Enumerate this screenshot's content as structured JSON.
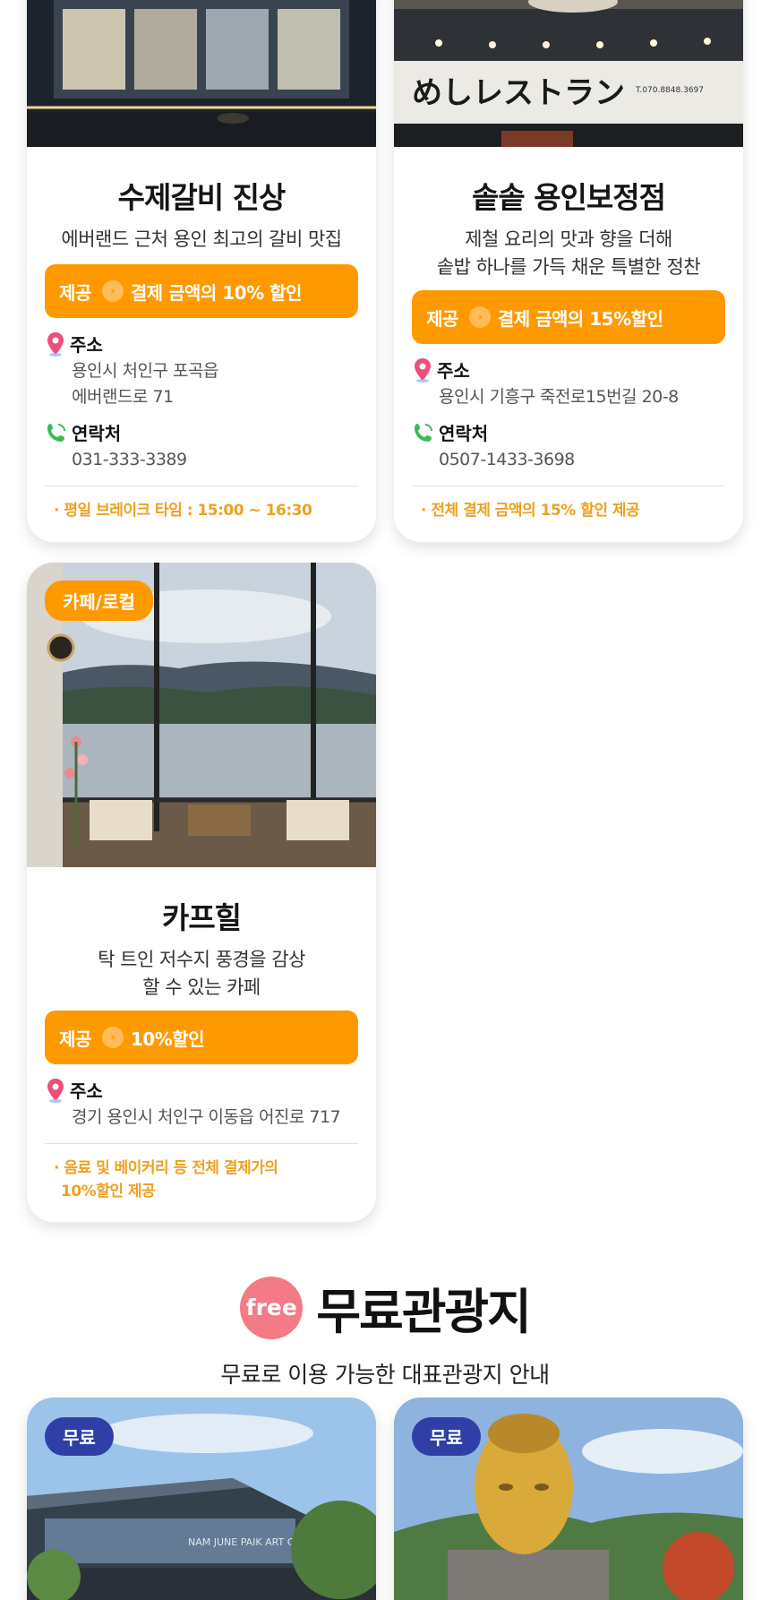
{
  "cards": [
    {
      "title": "수제갈비 진상",
      "desc_lines": [
        "에버랜드 근처 용인 최고의 갈비 맛집"
      ],
      "offer_label": "제공",
      "offer_text": "결제 금액의 10% 할인",
      "address_label": "주소",
      "address_lines": [
        "용인시 처인구 포곡읍",
        "에버랜드로 71"
      ],
      "contact_label": "연락처",
      "contact": "031-333-3389",
      "note_lines": [
        "· 평일 브레이크 타임 : 15:00 ~ 16:30"
      ]
    },
    {
      "title": "솥솥 용인보정점",
      "desc_lines": [
        "제철 요리의 맛과 향을 더해",
        "솥밥 하나를 가득 채운 특별한 정찬"
      ],
      "sign_text": "めしレストラン",
      "sign_phone": "T.070.8848.3697",
      "offer_label": "제공",
      "offer_text": "결제 금액의 15%할인",
      "address_label": "주소",
      "address_lines": [
        "용인시 기흥구 죽전로15번길 20-8"
      ],
      "contact_label": "연락처",
      "contact": "0507-1433-3698",
      "note_lines": [
        "· 전체 결제 금액의 15% 할인 제공"
      ]
    },
    {
      "badge": "카페/로컬",
      "title": "카프힐",
      "desc_lines": [
        "탁 트인 저수지 풍경을 감상",
        "할 수 있는 카페"
      ],
      "offer_label": "제공",
      "offer_text": "10%할인",
      "address_label": "주소",
      "address_lines": [
        "경기 용인시 처인구 이동읍 어진로 717"
      ],
      "note_lines": [
        "· 음료 및 베이커리 등 전체 결제가의",
        "10%할인 제공"
      ]
    }
  ],
  "section": {
    "badge": "free",
    "title": "무료관광지",
    "subtitle": "무료로 이용 가능한 대표관광지 안내"
  },
  "free_cards": [
    {
      "badge": "무료",
      "sign_text": "NAM JUNE PAIK ART CENTER"
    },
    {
      "badge": "무료"
    }
  ],
  "colors": {
    "accent": "#ff9900",
    "note": "#f0a020",
    "free_badge": "#f47a85",
    "blue_badge": "#2f3fa6"
  },
  "icons": [
    "location-pin-icon",
    "phone-icon",
    "chevron-right-icon"
  ]
}
